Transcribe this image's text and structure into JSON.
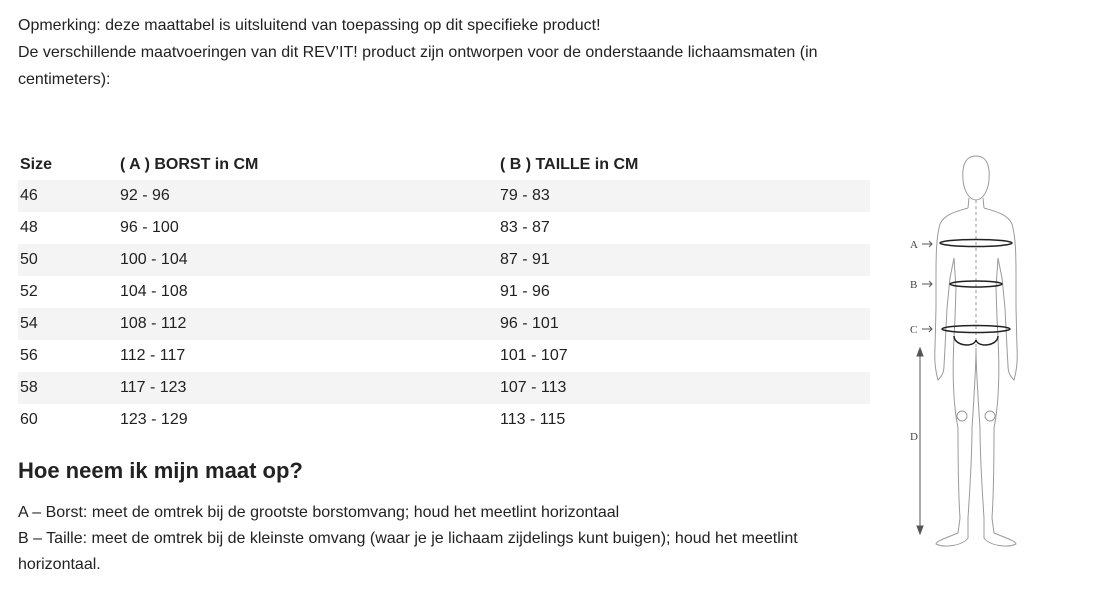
{
  "intro": {
    "line1": "Opmerking: deze maattabel is uitsluitend van toepassing op dit specifieke product!",
    "line2": "De verschillende maatvoeringen van dit REV’IT! product zijn ontworpen voor de onderstaande lichaamsmaten (in centimeters):"
  },
  "table": {
    "headers": [
      "Size",
      "( A ) BORST in CM",
      "( B ) TAILLE in CM"
    ],
    "rows": [
      [
        "46",
        "92 - 96",
        "79 - 83"
      ],
      [
        "48",
        "96 - 100",
        "83 - 87"
      ],
      [
        "50",
        "100 - 104",
        "87 - 91"
      ],
      [
        "52",
        "104 - 108",
        "91 - 96"
      ],
      [
        "54",
        "108 - 112",
        "96 - 101"
      ],
      [
        "56",
        "112 - 117",
        "101 - 107"
      ],
      [
        "58",
        "117 - 123",
        "107 - 113"
      ],
      [
        "60",
        "123 - 129",
        "113 - 115"
      ]
    ]
  },
  "howto": {
    "title": "Hoe neem ik mijn maat op?",
    "a_text": "A – Borst: meet de omtrek bij de grootste borstomvang; houd het meetlint horizontaal",
    "b_text": "B – Taille: meet de omtrek bij de kleinste omvang (waar je je lichaam zijdelings kunt buigen); houd het meetlint horizontaal."
  },
  "figure": {
    "label_a": "A",
    "label_b": "B",
    "label_c": "C",
    "label_d": "D"
  }
}
